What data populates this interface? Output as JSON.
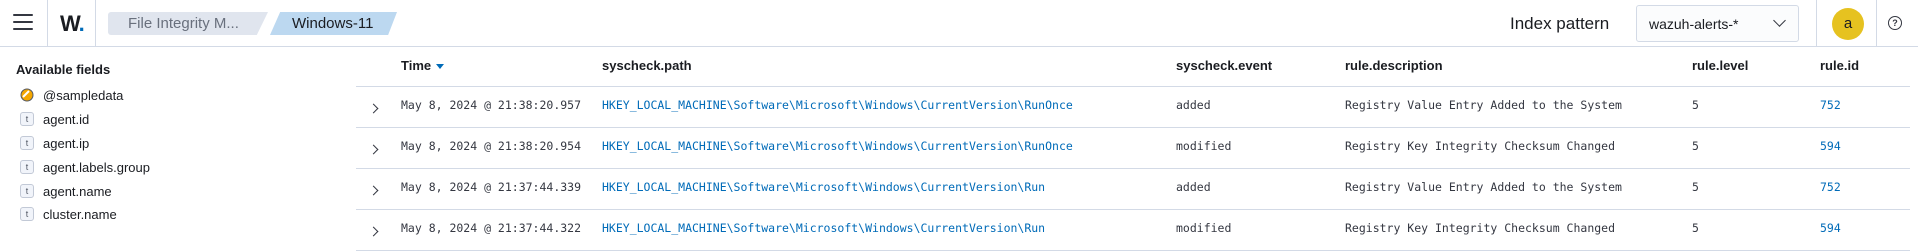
{
  "header": {
    "logo": "W",
    "logo_dot": ".",
    "breadcrumbs": [
      "File Integrity M...",
      "Windows-11"
    ],
    "index_pattern_label": "Index pattern",
    "index_pattern_value": "wazuh-alerts-*",
    "avatar_letter": "a",
    "help_glyph": "?"
  },
  "sidebar": {
    "title": "Available fields",
    "fields": [
      {
        "type": "geo",
        "name": "@sampledata"
      },
      {
        "type": "t",
        "name": "agent.id"
      },
      {
        "type": "t",
        "name": "agent.ip"
      },
      {
        "type": "t",
        "name": "agent.labels.group"
      },
      {
        "type": "t",
        "name": "agent.name"
      },
      {
        "type": "t",
        "name": "cluster.name"
      }
    ]
  },
  "table": {
    "columns": [
      "Time",
      "syscheck.path",
      "syscheck.event",
      "rule.description",
      "rule.level",
      "rule.id"
    ],
    "sorted_column": "Time",
    "rows": [
      {
        "time": "May 8, 2024 @ 21:38:20.957",
        "path": "HKEY_LOCAL_MACHINE\\Software\\Microsoft\\Windows\\CurrentVersion\\RunOnce",
        "event": "added",
        "description": "Registry Value Entry Added to the System",
        "level": "5",
        "id": "752"
      },
      {
        "time": "May 8, 2024 @ 21:38:20.954",
        "path": "HKEY_LOCAL_MACHINE\\Software\\Microsoft\\Windows\\CurrentVersion\\RunOnce",
        "event": "modified",
        "description": "Registry Key Integrity Checksum Changed",
        "level": "5",
        "id": "594"
      },
      {
        "time": "May 8, 2024 @ 21:37:44.339",
        "path": "HKEY_LOCAL_MACHINE\\Software\\Microsoft\\Windows\\CurrentVersion\\Run",
        "event": "added",
        "description": "Registry Value Entry Added to the System",
        "level": "5",
        "id": "752"
      },
      {
        "time": "May 8, 2024 @ 21:37:44.322",
        "path": "HKEY_LOCAL_MACHINE\\Software\\Microsoft\\Windows\\CurrentVersion\\Run",
        "event": "modified",
        "description": "Registry Key Integrity Checksum Changed",
        "level": "5",
        "id": "594"
      }
    ]
  },
  "colors": {
    "accent": "#006bb8",
    "avatar": "#e6c220",
    "breadcrumb_active": "#bcd8f0",
    "breadcrumb_inactive": "#e0e5ee"
  },
  "icons": {
    "menu": "hamburger-icon",
    "dropdown": "chevron-down-icon",
    "expand": "chevron-right-icon",
    "help": "help-icon",
    "geo_field": "geo-point-icon",
    "string_field": "string-field-icon"
  }
}
